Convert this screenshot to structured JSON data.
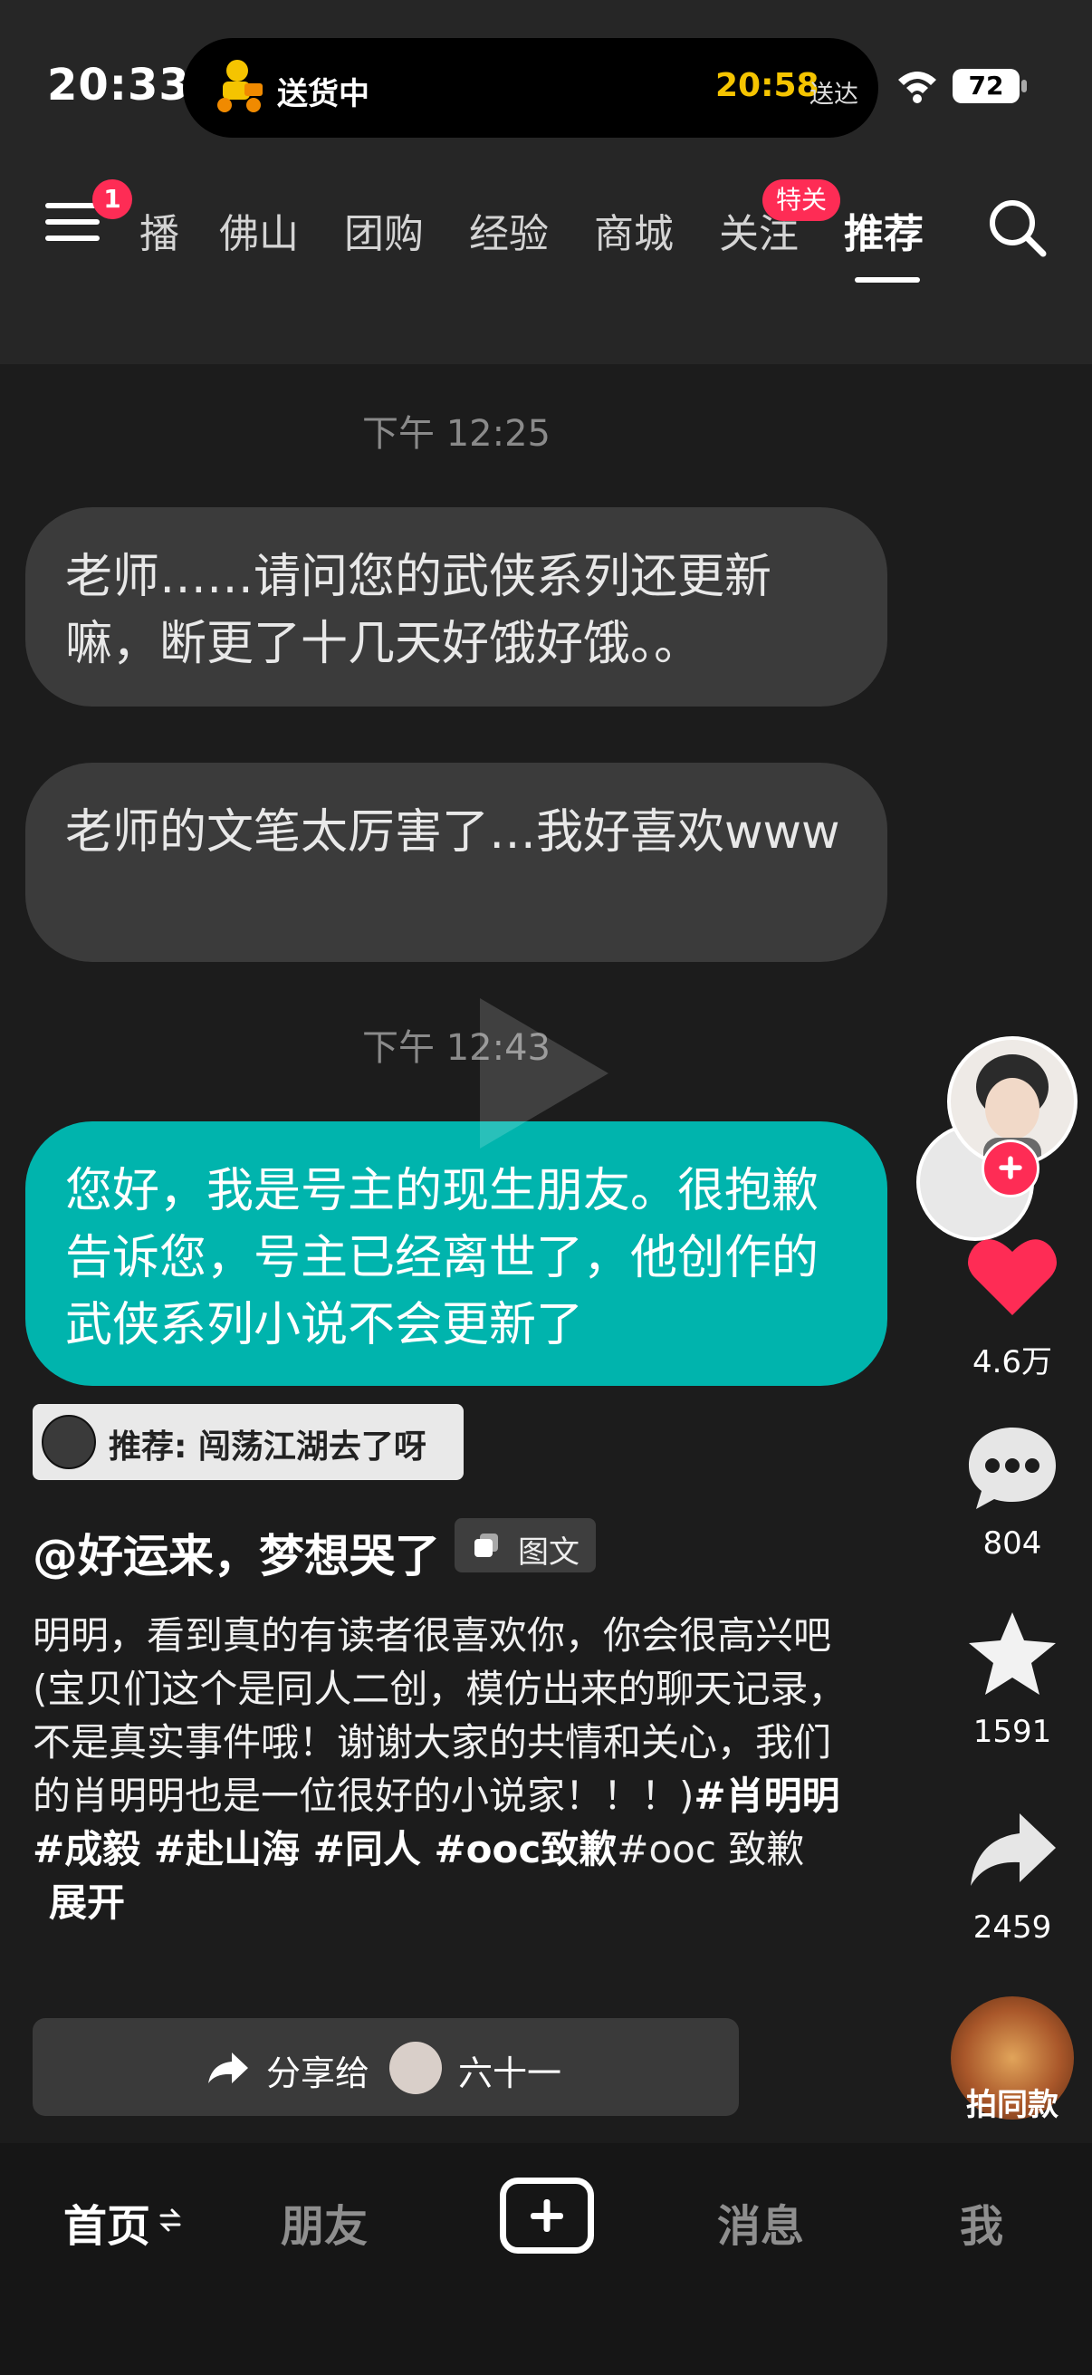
{
  "status_bar": {
    "time": "20:33",
    "island_status": "送货中",
    "eta_time": "20:58",
    "eta_label": "送达",
    "battery": "72"
  },
  "top_nav": {
    "menu_badge": "1",
    "tabs": [
      "播",
      "佛山",
      "团购",
      "经验",
      "商城",
      "关注",
      "推荐"
    ],
    "active_tab": "推荐",
    "follow_badge": "特关"
  },
  "chat": {
    "time_1": "下午 12:25",
    "message_1": "老师……请问您的武侠系列还更新嘛，断更了十几天好饿好饿。。",
    "message_2": "老师的文笔太厉害了…我好喜欢www",
    "time_2": "下午 12:43",
    "message_3": "您好，我是号主的现生朋友。很抱歉告诉您，号主已经离世了，他创作的武侠系列小说不会更新了"
  },
  "post": {
    "recommend": "推荐: 闯荡江湖去了呀",
    "author": "@好运来，梦想哭了",
    "type_tag": "图文",
    "desc_text": "明明，看到真的有读者很喜欢你，你会很高兴吧\n(宝贝们这个是同人二创，模仿出来的聊天记录，不是真实事件哦！谢谢大家的共情和关心，我们的肖明明也是一位很好的小说家！！！)",
    "hashtags": "#肖明明 #成毅 #赴山海 #同人 #ooc致歉",
    "desc_tail": "#ooc 致歉",
    "expand": "展开",
    "share_label": "分享给",
    "share_name": "六十一"
  },
  "rail": {
    "likes": "4.6万",
    "comments": "804",
    "favorites": "1591",
    "shares": "2459",
    "music_label": "拍同款"
  },
  "bottom_nav": {
    "home": "首页",
    "friends": "朋友",
    "messages": "消息",
    "me": "我"
  },
  "colors": {
    "accent_red": "#fe2c55",
    "teal_bubble": "#00b4ad",
    "eta_yellow": "#f5c400"
  }
}
